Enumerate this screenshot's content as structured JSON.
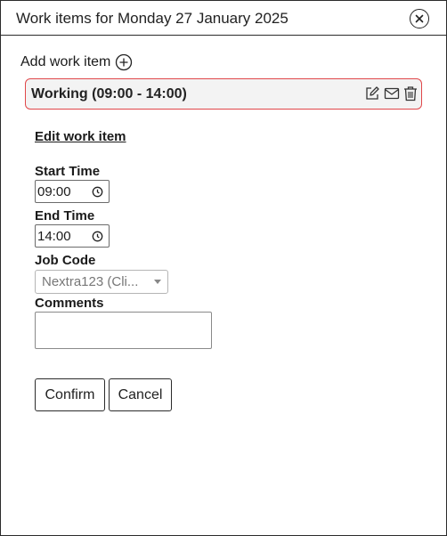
{
  "dialog": {
    "title": "Work items for Monday 27 January 2025",
    "close_icon": "close-circle-icon"
  },
  "add_item": {
    "label": "Add work item",
    "icon": "plus-circle-icon"
  },
  "work_item": {
    "title": "Working (09:00 - 14:00)",
    "border_color": "#e0474a",
    "icons": [
      "edit-icon",
      "mail-icon",
      "trash-icon"
    ]
  },
  "form": {
    "heading": "Edit work item",
    "start_time_label": "Start Time",
    "start_time_value": "09:00",
    "end_time_label": "End Time",
    "end_time_value": "14:00",
    "job_code_label": "Job Code",
    "job_code_value": "Nextra123 (Cli...",
    "comments_label": "Comments",
    "comments_value": "",
    "confirm_label": "Confirm",
    "cancel_label": "Cancel"
  }
}
